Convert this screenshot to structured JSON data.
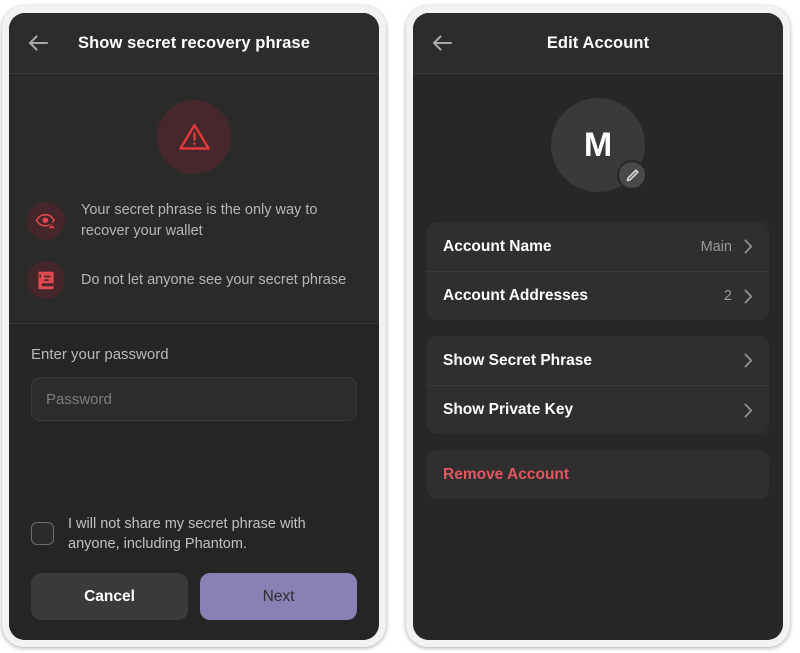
{
  "left_screen": {
    "header": {
      "back_icon": "arrow-left-icon",
      "title": "Show secret recovery phrase"
    },
    "warning": {
      "icon": "warning-triangle-icon",
      "bullets": [
        {
          "icon": "eye-warning-icon",
          "text": "Your secret phrase is the only way to recover your wallet"
        },
        {
          "icon": "note-secret-icon",
          "text": "Do not let anyone see your secret phrase"
        }
      ]
    },
    "password": {
      "label": "Enter your password",
      "placeholder": "Password",
      "value": ""
    },
    "consent": {
      "checked": false,
      "text": "I will not share my secret phrase with anyone, including Phantom."
    },
    "buttons": {
      "cancel_label": "Cancel",
      "next_label": "Next"
    }
  },
  "right_screen": {
    "header": {
      "back_icon": "arrow-left-icon",
      "title": "Edit Account"
    },
    "avatar": {
      "initial": "M",
      "edit_icon": "pencil-icon"
    },
    "card_one": [
      {
        "label": "Account Name",
        "value": "Main",
        "chevron": "chevron-right-icon"
      },
      {
        "label": "Account Addresses",
        "value": "2",
        "chevron": "chevron-right-icon"
      }
    ],
    "card_two": [
      {
        "label": "Show Secret Phrase",
        "value": "",
        "chevron": "chevron-right-icon"
      },
      {
        "label": "Show Private Key",
        "value": "",
        "chevron": "chevron-right-icon"
      }
    ],
    "card_three": [
      {
        "label": "Remove Account",
        "value": "",
        "chevron": ""
      }
    ]
  },
  "colors": {
    "accent_purple": "#8a80b4",
    "danger_red": "#e0575f",
    "warning_red": "#e03a3a",
    "screen_bg": "#252525",
    "card_bg": "#2f2f2f"
  }
}
